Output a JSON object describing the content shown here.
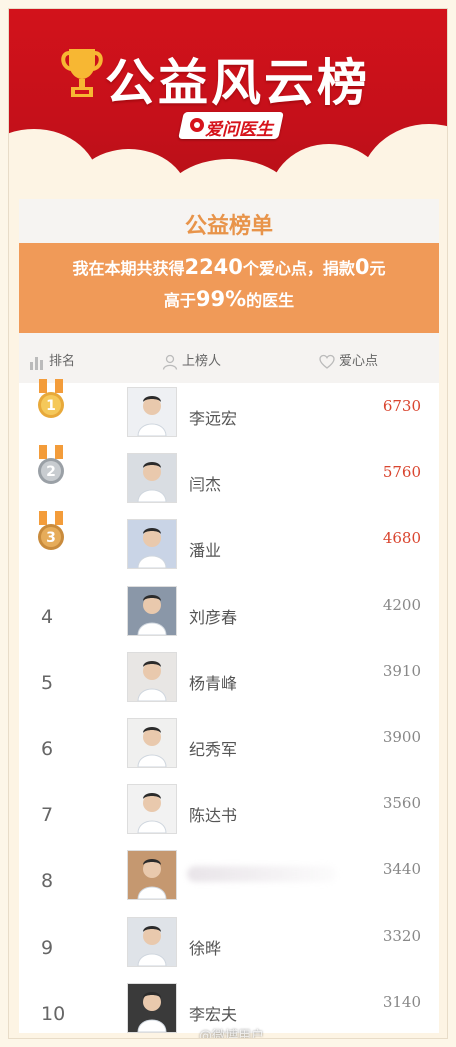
{
  "banner": {
    "title": "公益风云榜",
    "logo_text": "爱问医生"
  },
  "board": {
    "title": "公益榜单",
    "line1_prefix": "我在本期共获得",
    "line1_points": "2240",
    "line1_mid": "个爱心点，捐款",
    "line1_amount": "0",
    "line1_suffix": "元",
    "line2_prefix": "高于",
    "line2_percent": "99%",
    "line2_suffix": "的医生"
  },
  "columns": {
    "rank": "排名",
    "person": "上榜人",
    "points": "爱心点"
  },
  "rows": [
    {
      "rank": "1",
      "name": "李远宏",
      "points": "6730",
      "medal": "gold"
    },
    {
      "rank": "2",
      "name": "闫杰",
      "points": "5760",
      "medal": "silver"
    },
    {
      "rank": "3",
      "name": "潘业",
      "points": "4680",
      "medal": "bronze"
    },
    {
      "rank": "4",
      "name": "刘彦春",
      "points": "4200"
    },
    {
      "rank": "5",
      "name": "杨青峰",
      "points": "3910"
    },
    {
      "rank": "6",
      "name": "纪秀军",
      "points": "3900"
    },
    {
      "rank": "7",
      "name": "陈达书",
      "points": "3560"
    },
    {
      "rank": "8",
      "name": "",
      "points": "3440"
    },
    {
      "rank": "9",
      "name": "徐晔",
      "points": "3320"
    },
    {
      "rank": "10",
      "name": "李宏夫",
      "points": "3140"
    }
  ],
  "colors": {
    "banner_red": "#d2121b",
    "accent_orange": "#f09a58",
    "top_points": "#d9452f"
  }
}
